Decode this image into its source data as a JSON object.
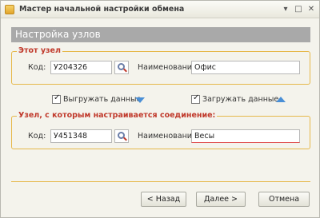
{
  "window": {
    "title": "Мастер начальной настройки обмена",
    "controls": {
      "menu": "▾",
      "maximize": "□",
      "close": "✕"
    }
  },
  "header": {
    "title": "Настройка узлов"
  },
  "this_node": {
    "legend": "Этот узел",
    "code_label": "Код:",
    "code_value": "У204326",
    "name_label": "Наименование:",
    "name_value": "Офис"
  },
  "options": {
    "export_label": "Выгружать данные",
    "export_checked": true,
    "import_label": "Загружать данные",
    "import_checked": true
  },
  "remote_node": {
    "legend": "Узел, с которым настраивается соединение:",
    "code_label": "Код:",
    "code_value": "У451348",
    "name_label": "Наименование:",
    "name_value": "Весы"
  },
  "footer": {
    "back_label": "< Назад",
    "next_label": "Далее >",
    "cancel_label": "Отмена"
  },
  "colors": {
    "accent_border": "#e6b84a",
    "legend_text": "#c0392b",
    "header_band": "#a9a9a9",
    "arrow": "#4a8fd6"
  }
}
